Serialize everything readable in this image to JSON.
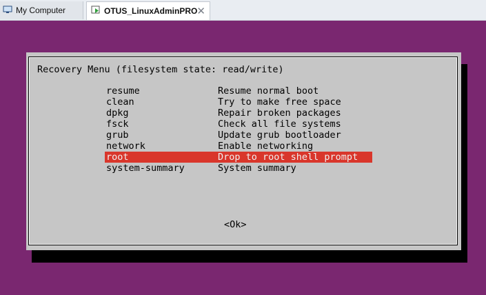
{
  "tabs": [
    {
      "label": "My Computer",
      "icon": "monitor-icon"
    },
    {
      "label": "OTUS_LinuxAdminPRO",
      "icon": "vm-icon",
      "close": "✕"
    }
  ],
  "dialog": {
    "title": "Recovery Menu (filesystem state: read/write)",
    "items": [
      {
        "tag": "resume",
        "desc": "Resume normal boot"
      },
      {
        "tag": "clean",
        "desc": "Try to make free space"
      },
      {
        "tag": "dpkg",
        "desc": "Repair broken packages"
      },
      {
        "tag": "fsck",
        "desc": "Check all file systems"
      },
      {
        "tag": "grub",
        "desc": "Update grub bootloader"
      },
      {
        "tag": "network",
        "desc": "Enable networking"
      },
      {
        "tag": "root",
        "desc": "Drop to root shell prompt",
        "selected": true
      },
      {
        "tag": "system-summary",
        "desc": "System summary"
      }
    ],
    "ok_label": "<Ok>"
  },
  "colors": {
    "background": "#7a2770",
    "dialog": "#c6c6c6",
    "highlight": "#d9362b"
  }
}
